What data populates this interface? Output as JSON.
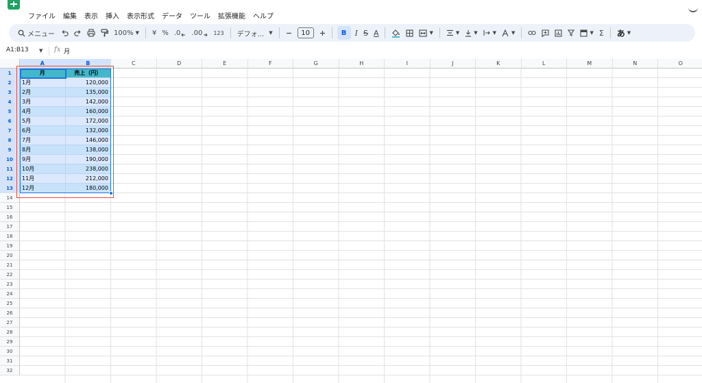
{
  "menu": {
    "items": [
      "ファイル",
      "編集",
      "表示",
      "挿入",
      "表示形式",
      "データ",
      "ツール",
      "拡張機能",
      "ヘルプ"
    ]
  },
  "toolbar": {
    "search_label": "メニュー",
    "zoom": "100%",
    "currency": "¥",
    "percent": "%",
    "decimal_decrease": ".0",
    "decimal_increase": ".00",
    "number_format": "123",
    "font_name": "デフォ...",
    "font_size": "10",
    "bold": "B",
    "italic": "I",
    "strike": "S",
    "text_color": "A",
    "input_mode": "あ",
    "sum": "Σ"
  },
  "formula_bar": {
    "name_box": "A1:B13",
    "fx": "fx",
    "content": "月"
  },
  "columns": [
    "A",
    "B",
    "C",
    "D",
    "E",
    "F",
    "G",
    "H",
    "I",
    "J",
    "K",
    "L",
    "M",
    "N",
    "O"
  ],
  "selected_columns": [
    "A",
    "B"
  ],
  "row_count": 32,
  "selected_rows": 13,
  "table": {
    "headers": [
      "月",
      "売上（円）"
    ],
    "rows": [
      [
        "1月",
        "120,000"
      ],
      [
        "2月",
        "135,000"
      ],
      [
        "3月",
        "142,000"
      ],
      [
        "4月",
        "160,000"
      ],
      [
        "5月",
        "172,000"
      ],
      [
        "6月",
        "132,000"
      ],
      [
        "7月",
        "146,000"
      ],
      [
        "8月",
        "138,000"
      ],
      [
        "9月",
        "190,000"
      ],
      [
        "10月",
        "238,000"
      ],
      [
        "11月",
        "212,000"
      ],
      [
        "12月",
        "180,000"
      ]
    ]
  },
  "colors": {
    "header_fill": "#46bdc6",
    "band_light": "#e8f0fe",
    "band_dark": "#d2e9fb",
    "selection": "#1a73e8",
    "annotation_box": "#e8483b",
    "toolbar_bg": "#edf2fa"
  }
}
